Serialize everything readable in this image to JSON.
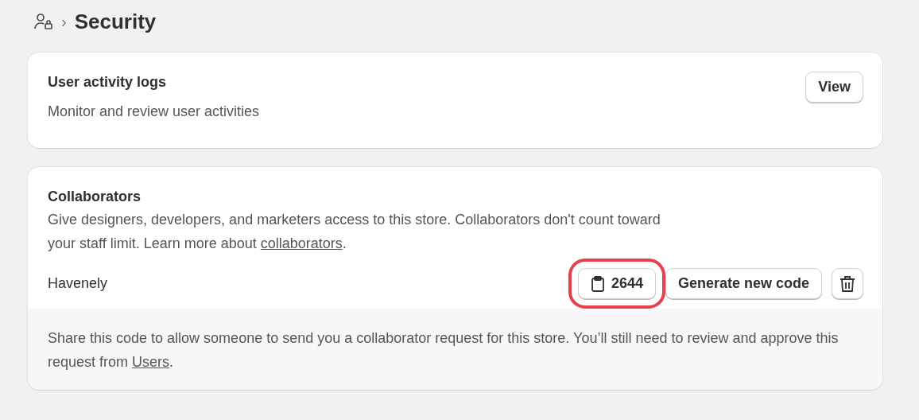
{
  "header": {
    "breadcrumb_separator": "›",
    "title": "Security"
  },
  "activity_card": {
    "title": "User activity logs",
    "description": "Monitor and review user activities",
    "button": "View"
  },
  "collaborators_card": {
    "title": "Collaborators",
    "description": {
      "before": "Give designers, developers, and marketers access to this store. Collaborators don't count toward your staff limit. Learn more about ",
      "link": "collaborators",
      "after": "."
    },
    "store_name": "Havenely",
    "code_button": {
      "label": "2644",
      "highlighted": true
    },
    "generate_button": "Generate new code",
    "footer": {
      "before": "Share this code to allow someone to send you a collaborator request for this store. You’ll still need to review and approve this request from ",
      "link": "Users",
      "after": "."
    }
  }
}
